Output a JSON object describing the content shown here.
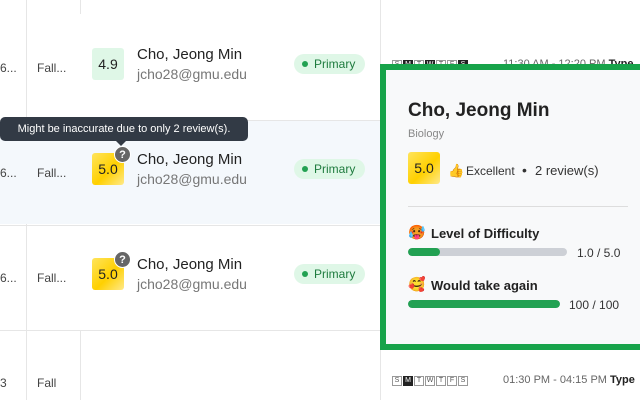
{
  "tooltip": "Might be inaccurate due to only 2 review(s).",
  "rows": [
    {
      "id": "6...",
      "term": "Fall...",
      "rating": "4.9",
      "name": "Cho, Jeong Min",
      "email": "jcho28@gmu.edu",
      "role": "Primary"
    },
    {
      "id": "6...",
      "term": "Fall...",
      "rating": "5.0",
      "name": "Cho, Jeong Min",
      "email": "jcho28@gmu.edu",
      "role": "Primary"
    },
    {
      "id": "6...",
      "term": "Fall...",
      "rating": "5.0",
      "name": "Cho, Jeong Min",
      "email": "jcho28@gmu.edu",
      "role": "Primary"
    },
    {
      "id": "3",
      "term": "Fall"
    }
  ],
  "qmark": "?",
  "schedules": [
    {
      "days": [
        "S",
        "M",
        "T",
        "W",
        "T",
        "F",
        "S"
      ],
      "on": [
        false,
        true,
        false,
        true,
        false,
        false,
        true
      ],
      "time": "11:30 AM - 12:20 PM",
      "type": "Type"
    },
    {
      "days": [
        "S",
        "M",
        "T",
        "W",
        "T",
        "F",
        "S"
      ],
      "on": [
        false,
        true,
        false,
        false,
        false,
        false,
        false
      ],
      "time": "01:30 PM - 04:15 PM",
      "type": "Type"
    }
  ],
  "popup": {
    "name": "Cho, Jeong Min",
    "department": "Biology",
    "rating": "5.0",
    "quality_icon": "👍",
    "quality": "Excellent",
    "bullet": "•",
    "reviews": "2 review(s)",
    "difficulty": {
      "icon": "🥵",
      "label": "Level of Difficulty",
      "value": "1.0 / 5.0",
      "fraction": 0.2
    },
    "take_again": {
      "icon": "🥰",
      "label": "Would take again",
      "value": "100 / 100",
      "fraction": 1.0
    }
  },
  "colors": {
    "accent": "#17a34a",
    "primary_badge": "#dff7e7",
    "tooltip_bg": "#323a45"
  }
}
